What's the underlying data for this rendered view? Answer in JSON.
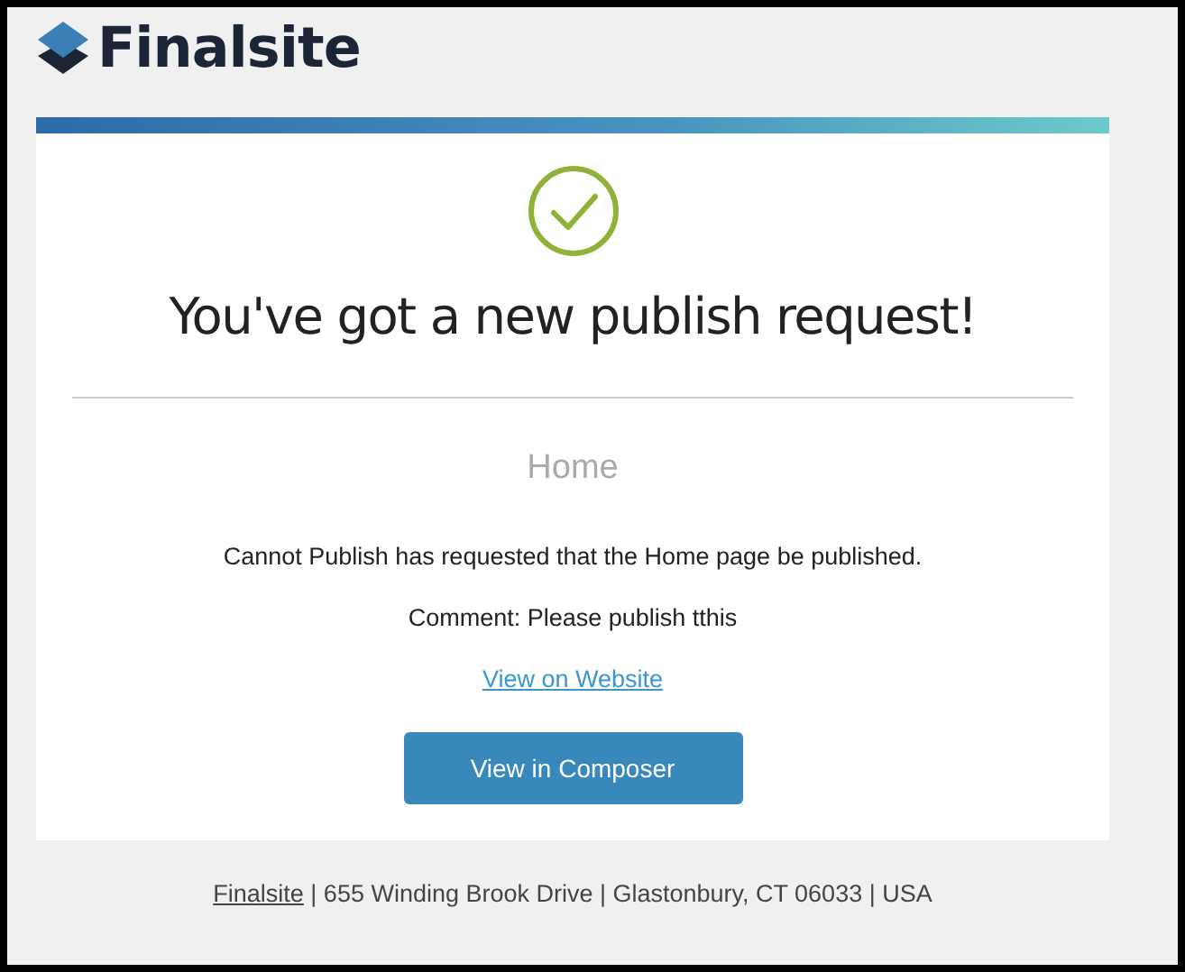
{
  "brand": {
    "name": "Finalsite"
  },
  "email": {
    "heading": "You've got a new publish request!",
    "page_name": "Home",
    "message": "Cannot Publish has requested that the Home page be published.",
    "comment": "Comment: Please publish tthis",
    "link": "View on Website",
    "button": "View in Composer"
  },
  "footer": {
    "link": "Finalsite",
    "address": " | 655 Winding Brook Drive | Glastonbury, CT 06033 | USA"
  }
}
